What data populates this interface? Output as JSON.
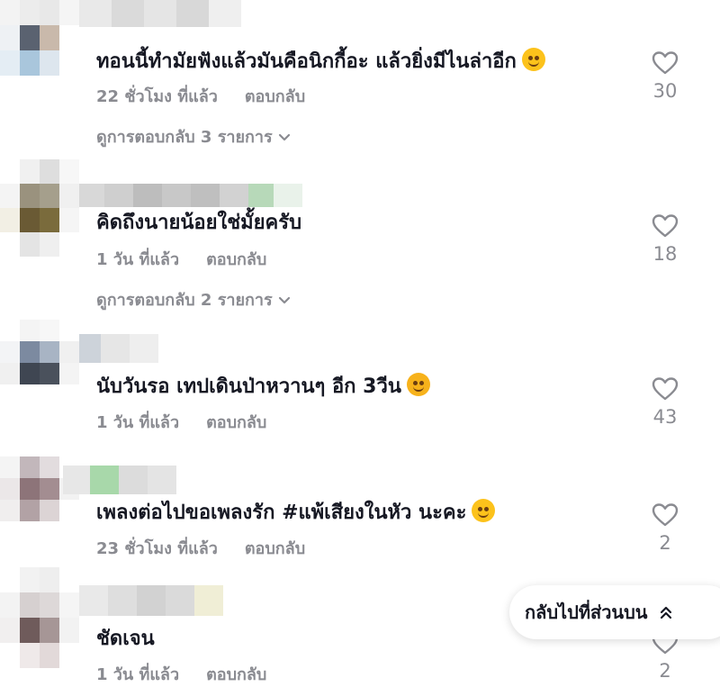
{
  "comments": [
    {
      "text": "ทอนนี้ทำมัยฟังแล้วมันคือนิกกี้อะ แล้วยิ่งมีไนล่าอีก",
      "emoji": "smiling-face-emoji",
      "time": "22 ชั่วโมง ที่แล้ว",
      "reply": "ตอบกลับ",
      "likes": "30",
      "view_replies": "ดูการตอบกลับ 3 รายการ"
    },
    {
      "text": "คิดถึงนายน้อยใช่มั้ยครับ",
      "time": "1 วัน ที่แล้ว",
      "reply": "ตอบกลับ",
      "likes": "18",
      "view_replies": "ดูการตอบกลับ 2 รายการ"
    },
    {
      "text": "นับวันรอ เทปเดินป่าหวานๆ อีก 3วีน",
      "emoji": "smiling-face-with-hearts-emoji",
      "time": "1 วัน ที่แล้ว",
      "reply": "ตอบกลับ",
      "likes": "43"
    },
    {
      "text": "เพลงต่อไปขอเพลงรัก #แพ้เสียงในหัว นะคะ",
      "emoji": "smiling-face-emoji",
      "time": "23 ชั่วโมง ที่แล้ว",
      "reply": "ตอบกลับ",
      "likes": "2"
    },
    {
      "text": "ชัดเจน",
      "time": "1 วัน ที่แล้ว",
      "reply": "ตอบกลับ",
      "likes": "2"
    }
  ],
  "back_to_top": "กลับไปที่ส่วนบน",
  "colors": {
    "text": "#161823",
    "muted": "#8a8b91",
    "emoji": "#fcc21b"
  }
}
